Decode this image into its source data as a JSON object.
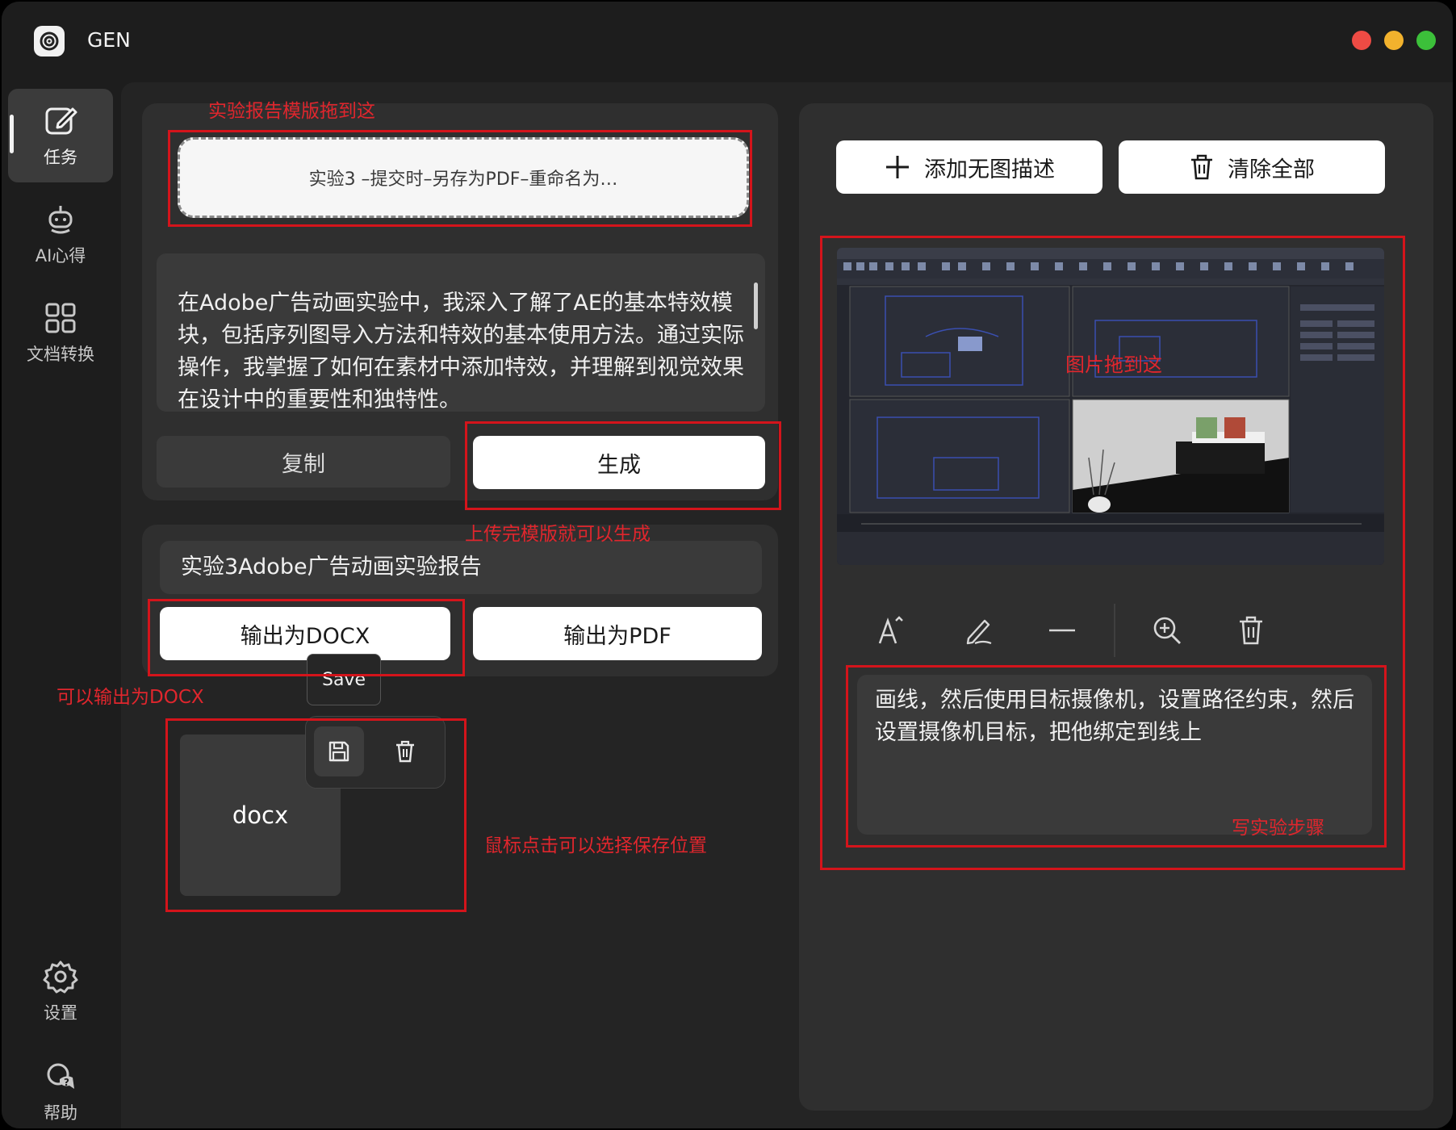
{
  "app": {
    "title": "GEN"
  },
  "colors": {
    "accent_red": "#d4141b",
    "annotation_red": "#e0262d",
    "traffic_red": "#ee4b44",
    "traffic_yellow": "#f2b22d",
    "traffic_green": "#3cc03a"
  },
  "sidebar": {
    "items": [
      {
        "label": "任务",
        "icon": "edit-icon"
      },
      {
        "label": "AI心得",
        "icon": "robot-icon"
      },
      {
        "label": "文档转换",
        "icon": "grid-icon"
      },
      {
        "label": "设置",
        "icon": "gear-icon"
      },
      {
        "label": "帮助",
        "icon": "help-chat-icon"
      }
    ]
  },
  "template": {
    "dropzone_text": "实验3 –提交时–另存为PDF–重命名为…",
    "annotation": "实验报告模版拖到这"
  },
  "summary": {
    "text": "在Adobe广告动画实验中，我深入了解了AE的基本特效模块，包括序列图导入方法和特效的基本使用方法。通过实际操作，我掌握了如何在素材中添加特效，并理解到视觉效果在设计中的重要性和独特性。"
  },
  "actions": {
    "copy_label": "复制",
    "generate_label": "生成",
    "generate_annotation": "上传完模版就可以生成"
  },
  "output": {
    "filename": "实验3Adobe广告动画实验报告",
    "docx_label": "输出为DOCX",
    "pdf_label": "输出为PDF",
    "docx_annotation": "可以输出为DOCX",
    "tooltip": "Save",
    "file_card_label": "docx",
    "file_annotation": "鼠标点击可以选择保存位置"
  },
  "right_panel": {
    "add_label": "添加无图描述",
    "clear_label": "清除全部",
    "image_annotation": "图片拖到这",
    "step_text": "画线，然后使用目标摄像机，设置路径约束，然后设置摄像机目标，把他绑定到线上",
    "step_annotation": "写实验步骤",
    "tools": [
      "text-size-icon",
      "pen-icon",
      "line-icon",
      "zoom-in-icon",
      "trash-icon"
    ]
  }
}
